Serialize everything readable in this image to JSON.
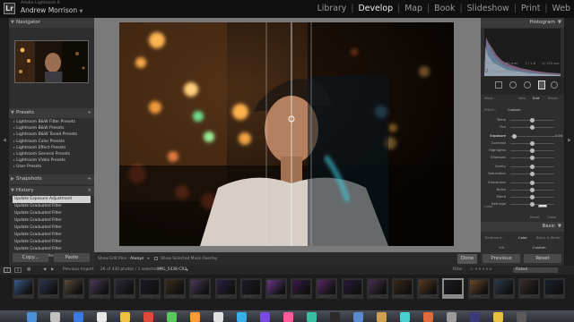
{
  "app": {
    "product_name": "Adobe Lightroom 6",
    "user_name": "Andrew Morrison",
    "logo_text": "Lr",
    "modules": [
      "Library",
      "Develop",
      "Map",
      "Book",
      "Slideshow",
      "Print",
      "Web"
    ],
    "active_module": "Develop"
  },
  "left_panel": {
    "navigator": {
      "title": "Navigator"
    },
    "presets": {
      "title": "Presets",
      "items": [
        "Lightroom B&W Filter Presets",
        "Lightroom B&W Presets",
        "Lightroom B&W Toned Presets",
        "Lightroom Color Presets",
        "Lightroom Effect Presets",
        "Lightroom General Presets",
        "Lightroom Video Presets",
        "User Presets"
      ]
    },
    "snapshots": {
      "title": "Snapshots"
    },
    "history": {
      "title": "History",
      "items": [
        "Update Exposure Adjustment",
        "Update Graduated Filter",
        "Update Graduated Filter",
        "Update Graduated Filter",
        "Update Graduated Filter",
        "Update Graduated Filter",
        "Update Graduated Filter",
        "Update Graduated Filter",
        "Add Graduated Filter"
      ],
      "selected_index": 0
    },
    "copy_label": "Copy...",
    "paste_label": "Paste"
  },
  "toolbar": {
    "show_edit_pins_label": "Show Edit Pins :",
    "show_edit_pins_value": "Always",
    "show_mask_label": "Show Selected Mask Overlay",
    "done_label": "Done"
  },
  "right_panel": {
    "histogram_title": "Histogram",
    "meta": [
      "ISO 1600",
      "50 mm",
      "f / 1.8",
      "1/ 125 sec"
    ],
    "original_photo_label": "Original Photo",
    "mask_label": "Mask :",
    "mask_new": "New",
    "mask_edit": "Edit",
    "mask_brush": "Brush",
    "effect_label": "Effect :",
    "effect_value": "Custom",
    "sliders": [
      {
        "label": "Temp",
        "value": "",
        "pos": 0.5
      },
      {
        "label": "Tint",
        "value": "",
        "pos": 0.5
      },
      {
        "label": "Exposure",
        "value": "- 4.00",
        "pos": 0.1
      },
      {
        "label": "Contrast",
        "value": "",
        "pos": 0.5
      },
      {
        "label": "Highlights",
        "value": "",
        "pos": 0.5
      },
      {
        "label": "Shadows",
        "value": "",
        "pos": 0.5
      },
      {
        "label": "Clarity",
        "value": "",
        "pos": 0.5
      },
      {
        "label": "Saturation",
        "value": "",
        "pos": 0.5
      },
      {
        "label": "Sharpness",
        "value": "",
        "pos": 0.5
      },
      {
        "label": "Noise",
        "value": "",
        "pos": 0.5
      },
      {
        "label": "Moiré",
        "value": "",
        "pos": 0.5
      },
      {
        "label": "Defringe",
        "value": "",
        "pos": 0.5
      }
    ],
    "color_label": "Color",
    "reset_label": "Reset",
    "close_label": "Close",
    "basic_title": "Basic",
    "treatment_label": "Treatment :",
    "treatment_color": "Color",
    "treatment_bw": "Black & White",
    "wb_label": "WB :",
    "wb_value": "Custom",
    "previous_label": "Previous",
    "reset_bottom_label": "Reset"
  },
  "filmstrip": {
    "page_numbers": [
      "1",
      "2"
    ],
    "source_label": "Previous Import",
    "count_label": "26 of 430 photos / 1 selected /",
    "filename": "IMG_5438.CR2",
    "filter_label": "Filter :",
    "filter_value": "Rated"
  },
  "colors": {
    "panel_bg": "#2e2e2e",
    "active_module": "#eeeeee",
    "selected_history": "#d2d2d2"
  }
}
